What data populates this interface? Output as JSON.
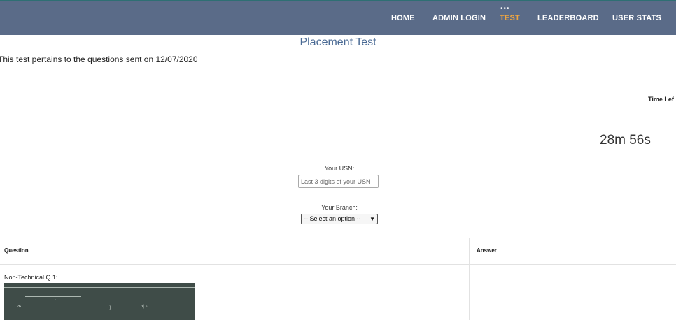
{
  "nav": {
    "items": [
      {
        "label": "HOME",
        "active": false
      },
      {
        "label": "ADMIN LOGIN",
        "active": false
      },
      {
        "label": "TEST",
        "active": true
      },
      {
        "label": "LEADERBOARD",
        "active": false
      },
      {
        "label": "USER STATS",
        "active": false
      }
    ],
    "active_color": "#f0a640",
    "bar_color": "#5a6b88"
  },
  "page": {
    "title": "Placement Test",
    "subtitle": "This test pertains to the questions sent on 12/07/2020"
  },
  "timer": {
    "label": "Time Lef",
    "value": "28m 56s"
  },
  "form": {
    "usn_label": "Your USN:",
    "usn_placeholder": "Last 3 digits of your USN",
    "branch_label": "Your Branch:",
    "branch_selected": "-- Select an option --"
  },
  "table": {
    "headers": [
      "Question",
      "Answer"
    ],
    "rows": [
      {
        "label": "Non-Technical Q.1:"
      }
    ]
  }
}
